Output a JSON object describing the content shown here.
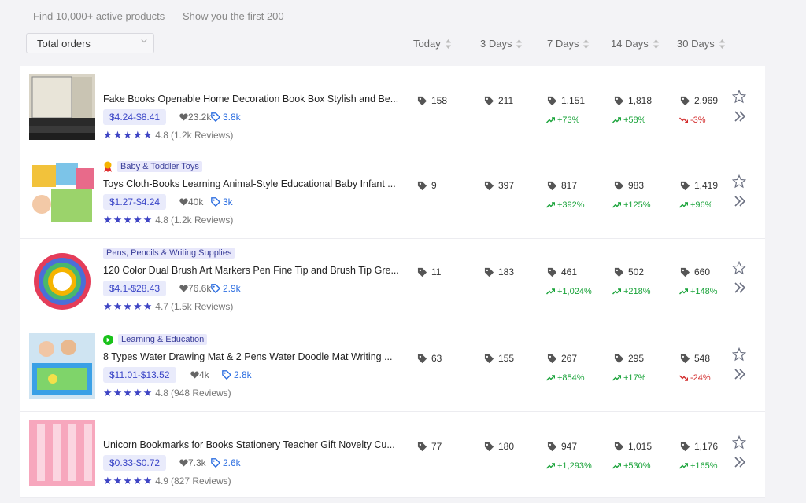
{
  "header": {
    "found_text": "Find 10,000+ active products",
    "showing_text": "Show you the first 200",
    "sort_value": "Total orders"
  },
  "columns": [
    "Today",
    "3 Days",
    "7 Days",
    "14 Days",
    "30 Days"
  ],
  "products": [
    {
      "category": "",
      "title": "Fake Books Openable Home Decoration Book Box Stylish and Be...",
      "price": "$4.24-$8.41",
      "wishlist": "23.2k",
      "tags": "3.8k",
      "rating": "4.8",
      "reviews": "(1.2k Reviews)",
      "orders": [
        "158",
        "211",
        "1,151",
        "1,818",
        "2,969"
      ],
      "growth": [
        {
          "v": "+73%",
          "dir": "up"
        },
        {
          "v": "+58%",
          "dir": "up"
        },
        {
          "v": "-3%",
          "dir": "down"
        }
      ]
    },
    {
      "category": "Baby & Toddler Toys",
      "category_icon": "medal-icon",
      "title": "Toys Cloth-Books Learning Animal-Style Educational Baby Infant ...",
      "price": "$1.27-$4.24",
      "wishlist": "40k",
      "tags": "3k",
      "rating": "4.8",
      "reviews": "(1.2k Reviews)",
      "orders": [
        "9",
        "397",
        "817",
        "983",
        "1,419"
      ],
      "growth": [
        {
          "v": "+392%",
          "dir": "up"
        },
        {
          "v": "+125%",
          "dir": "up"
        },
        {
          "v": "+96%",
          "dir": "up"
        }
      ]
    },
    {
      "category": "Pens, Pencils & Writing Supplies",
      "category_icon": "",
      "title": "120 Color Dual Brush Art Markers Pen Fine Tip and Brush Tip Gre...",
      "price": "$4.1-$28.43",
      "wishlist": "76.6k",
      "tags": "2.9k",
      "rating": "4.7",
      "reviews": "(1.5k Reviews)",
      "orders": [
        "11",
        "183",
        "461",
        "502",
        "660"
      ],
      "growth": [
        {
          "v": "+1,024%",
          "dir": "up"
        },
        {
          "v": "+218%",
          "dir": "up"
        },
        {
          "v": "+148%",
          "dir": "up"
        }
      ]
    },
    {
      "category": "Learning & Education",
      "category_icon": "play-icon",
      "title": "8 Types Water Drawing Mat & 2 Pens Water Doodle Mat Writing ...",
      "price": "$11.01-$13.52",
      "wishlist": "4k",
      "tags": "2.8k",
      "rating": "4.8",
      "reviews": "(948 Reviews)",
      "orders": [
        "63",
        "155",
        "267",
        "295",
        "548"
      ],
      "growth": [
        {
          "v": "+854%",
          "dir": "up"
        },
        {
          "v": "+17%",
          "dir": "up"
        },
        {
          "v": "-24%",
          "dir": "down"
        }
      ]
    },
    {
      "category": "",
      "title": "Unicorn Bookmarks for Books Stationery Teacher Gift Novelty Cu...",
      "price": "$0.33-$0.72",
      "wishlist": "7.3k",
      "tags": "2.6k",
      "rating": "4.9",
      "reviews": "(827 Reviews)",
      "orders": [
        "77",
        "180",
        "947",
        "1,015",
        "1,176"
      ],
      "growth": [
        {
          "v": "+1,293%",
          "dir": "up"
        },
        {
          "v": "+530%",
          "dir": "up"
        },
        {
          "v": "+165%",
          "dir": "up"
        }
      ]
    }
  ],
  "colors": {
    "accent": "#3e44c4",
    "up": "#1aa33a",
    "down": "#d22b2b"
  }
}
